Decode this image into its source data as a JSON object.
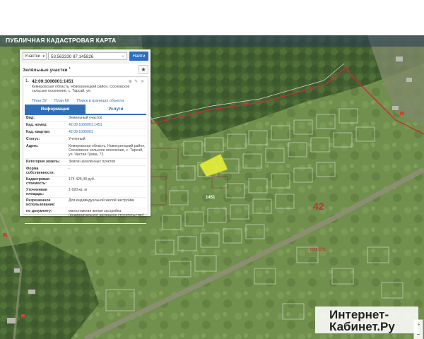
{
  "app": {
    "title": "ПУБЛИЧНАЯ КАДАСТРОВАЯ КАРТА"
  },
  "search": {
    "type_select": "Участки",
    "query": "53,563330 87,145826",
    "find_button": "Найти"
  },
  "results": {
    "header": "Зелёльные участки",
    "count": "1"
  },
  "parcel": {
    "index": "1.",
    "number": "42:09:1006001:1451",
    "address": "Кемеровская область, Новокузнецкий район, Сосновское сельское поселение, с. Тарсай, ул.",
    "links": [
      "План ЗУ",
      "План КК",
      "Поиск в границах объекта"
    ],
    "tabs": {
      "info": "Информация",
      "services": "Услуги"
    },
    "fields": [
      {
        "k": "Вид:",
        "v": "Земельный участок"
      },
      {
        "k": "Кад. номер:",
        "v": "42:09:1006001:1451",
        "link": true
      },
      {
        "k": "Кад. квартал:",
        "v": "42:09:1006001",
        "link": true
      },
      {
        "k": "Статус:",
        "v": "Учтенный"
      },
      {
        "k": "Адрес:",
        "v": "Кемеровская область, Новокузнецкий район, Сосновское сельское поселение, с. Тарсай, ул. Чистая Грива, 73"
      },
      {
        "k": "Категория земель:",
        "v": "Земли населённых пунктов"
      },
      {
        "k": "Форма собственности:",
        "v": "-"
      },
      {
        "k": "Кадастровая стоимость:",
        "v": "174 425,40 руб."
      },
      {
        "k": "Уточненная площадь:",
        "v": "1 620 кв. м"
      },
      {
        "k": "Разрешенное использование:",
        "v": "Для индивидуальной жилой застройки"
      },
      {
        "k": "по документу:",
        "v": "малоэтажная жилая застройка (индивидуальное жилищное строительство)"
      }
    ]
  },
  "map": {
    "quarter_number": "42",
    "zone_label": "1006001",
    "selected_label": "1451",
    "zoom_in": "+",
    "zoom_out": "−"
  },
  "watermark": {
    "line1": "Интернет-",
    "line2": "Кабинет.Ру"
  },
  "colors": {
    "accent": "#2f6fb7",
    "boundary": "#c0313a",
    "selected": "#e6ef3a"
  }
}
